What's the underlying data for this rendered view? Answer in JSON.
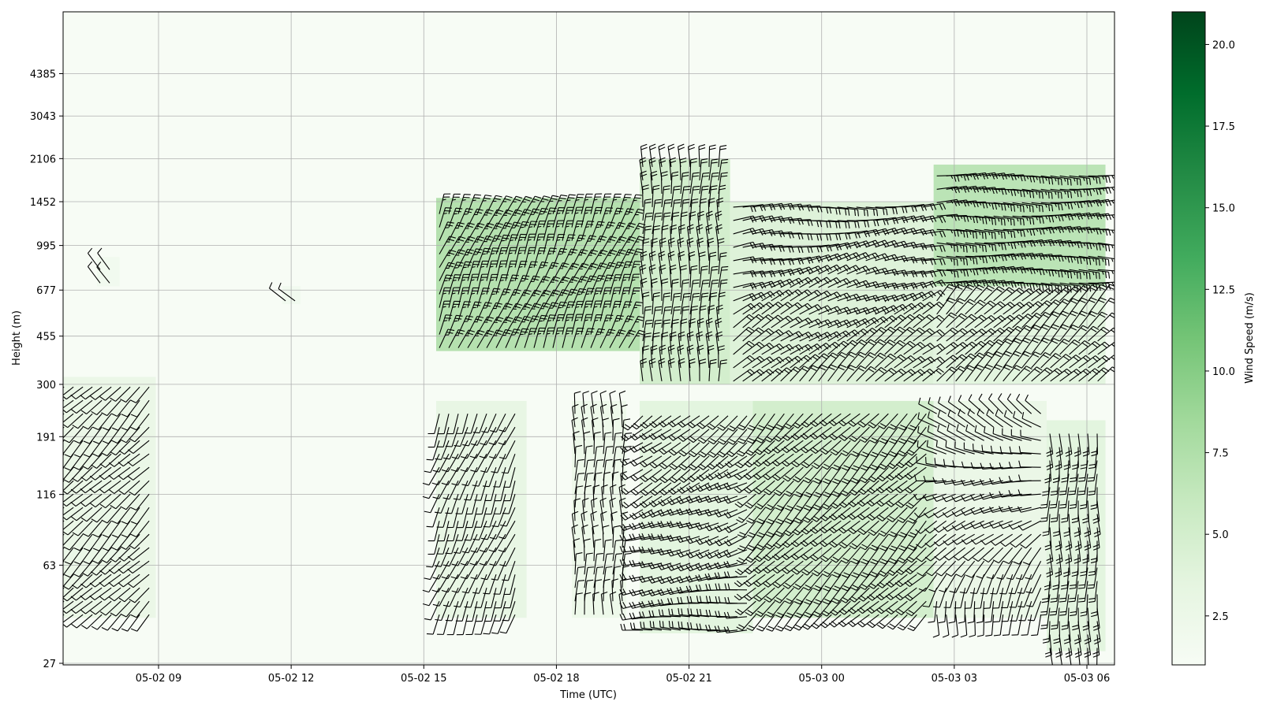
{
  "chart_data": {
    "type": "heatmap",
    "subtype": "wind-barbs-over-speed-heatmap",
    "title": "",
    "xlabel": "Time (UTC)",
    "ylabel": "Height (m)",
    "colorbar_label": "Wind Speed (m/s)",
    "colormap": [
      "#f7fcf5",
      "#e5f5e0",
      "#c7e9c0",
      "#a1d99b",
      "#74c476",
      "#41ab5d",
      "#238b45",
      "#006d2c",
      "#00441b"
    ],
    "barb_color": "#000000",
    "grid": true,
    "x_range": [
      "05-02 06:45",
      "05-03 06:00"
    ],
    "x_ticks": [
      "05-02 09",
      "05-02 12",
      "05-02 15",
      "05-02 18",
      "05-02 21",
      "05-03 00",
      "05-03 03",
      "05-03 06"
    ],
    "y_scale": "log",
    "y_ticks": [
      27,
      63,
      116,
      191,
      300,
      455,
      677,
      995,
      1452,
      2106,
      3043,
      4385
    ],
    "colorbar_range": [
      1.0,
      21.0
    ],
    "colorbar_ticks": [
      "2.5",
      "5.0",
      "7.5",
      "10.0",
      "12.5",
      "15.0",
      "17.5",
      "20.0"
    ],
    "regions": [
      {
        "t": [
          15.0,
          19.5
        ],
        "h": [
          400,
          1500
        ],
        "speed": 8.0,
        "direction": "NNE",
        "rotation": "backs to S near 300 m"
      },
      {
        "t": [
          19.5,
          21.5
        ],
        "h": [
          300,
          2100
        ],
        "speed": 5.5,
        "direction": "N"
      },
      {
        "t": [
          21.5,
          26.0
        ],
        "h": [
          300,
          1450
        ],
        "speed": 4.5,
        "direction": "NE veering to E aloft"
      },
      {
        "t": [
          26.0,
          29.8
        ],
        "h": [
          700,
          2000
        ],
        "speed": 7.5,
        "direction": "E"
      },
      {
        "t": [
          26.0,
          29.8
        ],
        "h": [
          300,
          700
        ],
        "speed": 4.0,
        "direction": "NE"
      },
      {
        "t": [
          15.0,
          17.0
        ],
        "h": [
          40,
          260
        ],
        "speed": 3.5,
        "direction": "SSW"
      },
      {
        "t": [
          18.0,
          19.2
        ],
        "h": [
          40,
          260
        ],
        "speed": 2.5,
        "direction": "N"
      },
      {
        "t": [
          19.5,
          22.0
        ],
        "h": [
          35,
          260
        ],
        "speed": 4.0,
        "direction": "W to SW"
      },
      {
        "t": [
          22.0,
          26.0
        ],
        "h": [
          40,
          260
        ],
        "speed": 5.5,
        "direction": "SW"
      },
      {
        "t": [
          26.0,
          28.5
        ],
        "h": [
          40,
          260
        ],
        "speed": 3.0,
        "direction": "S to NW"
      },
      {
        "t": [
          28.5,
          29.8
        ],
        "h": [
          30,
          220
        ],
        "speed": 4.0,
        "direction": "S"
      },
      {
        "t": [
          6.7,
          8.8
        ],
        "h": [
          40,
          320
        ],
        "speed": 3.0,
        "direction": "SW"
      },
      {
        "t": [
          7.5,
          8.0
        ],
        "h": [
          700,
          900
        ],
        "speed": 2.0,
        "direction": "NW"
      },
      {
        "t": [
          11.6,
          12.0
        ],
        "h": [
          600,
          700
        ],
        "speed": 2.0,
        "direction": "NW"
      }
    ]
  }
}
